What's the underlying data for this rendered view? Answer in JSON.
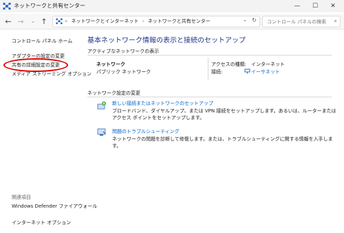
{
  "window": {
    "title": "ネットワークと共有センター",
    "min_glyph": "—",
    "max_glyph": "☐",
    "close_glyph": "✕"
  },
  "nav": {
    "back_glyph": "←",
    "forward_glyph": "→",
    "dropdown_glyph": "⌄",
    "up_glyph": "↑",
    "breadcrumbs": [
      "«",
      "ネットワークとインターネット",
      "›",
      "ネットワークと共有センター"
    ],
    "address_dropdown_glyph": "⌄",
    "refresh_glyph": "↻",
    "search_placeholder": "コントロール パネルの検索",
    "search_glyph": "⌕"
  },
  "sidebar": {
    "home": "コントロール パネル ホーム",
    "items": [
      "アダプターの設定の変更",
      "共有の詳細設定の変更",
      "メディア ストリーミング オプション"
    ],
    "see_also_label": "関連項目",
    "see_also": [
      "Windows Defender ファイアウォール",
      "インターネット オプション"
    ]
  },
  "main": {
    "heading": "基本ネットワーク情報の表示と接続のセットアップ",
    "active_networks_label": "アクティブなネットワークの表示",
    "network": {
      "name": "ネットワーク",
      "type": "パブリック ネットワーク",
      "access_type_label": "アクセスの種類:",
      "access_type_value": "インターネット",
      "connections_label": "接続:",
      "connection_value": "イーサネット"
    },
    "change_settings_label": "ネットワーク設定の変更",
    "tasks": [
      {
        "title": "新しい接続またはネットワークのセットアップ",
        "description": "ブロードバンド、ダイヤルアップ、または VPN 接続をセットアップします。あるいは、ルーターまたはアクセス ポイントをセットアップします。"
      },
      {
        "title": "問題のトラブルシューティング",
        "description": "ネットワークの問題を診断して修復します。または、トラブルシューティングに関する情報を入手します。"
      }
    ]
  },
  "colors": {
    "accent": "#0066cc",
    "heading": "#1e3287",
    "highlight_ring": "#e00000"
  }
}
